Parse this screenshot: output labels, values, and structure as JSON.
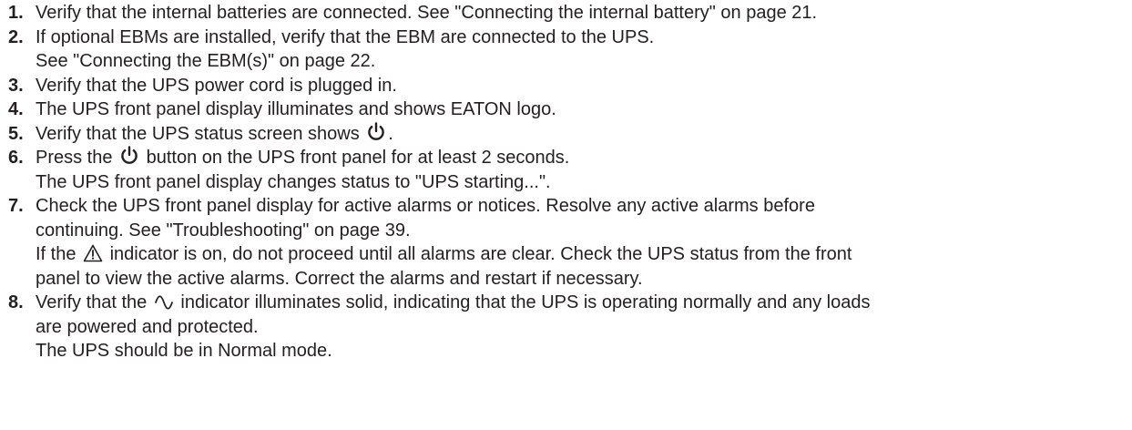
{
  "steps": [
    {
      "number": "1.",
      "lines": [
        "Verify that the internal batteries are connected. See \"Connecting the internal battery\" on page 21."
      ]
    },
    {
      "number": "2.",
      "lines": [
        "If optional EBMs are installed, verify that the EBM are connected to the UPS.",
        "See \"Connecting the EBM(s)\" on page 22."
      ]
    },
    {
      "number": "3.",
      "lines": [
        "Verify that the UPS power cord is plugged in."
      ]
    },
    {
      "number": "4.",
      "lines": [
        "The UPS front panel display illuminates and shows EATON logo."
      ]
    },
    {
      "number": "5.",
      "before": "Verify that the UPS status screen shows ",
      "icon": "power-icon",
      "after": "."
    },
    {
      "number": "6.",
      "before": "Press the ",
      "icon": "power-icon",
      "after": " button on the UPS front panel for at least 2 seconds.",
      "extra": "The UPS front panel display changes status to \"UPS starting...\"."
    },
    {
      "number": "7.",
      "lines": [
        "Check the UPS front panel display for active alarms or notices. Resolve any active alarms before",
        "continuing. See \"Troubleshooting\" on page 39."
      ],
      "before": "If the ",
      "icon": "warning-triangle-icon",
      "after": " indicator is on, do not proceed until all alarms are clear. Check the UPS status from the front",
      "extra": "panel to view the active alarms. Correct the alarms and restart if necessary."
    },
    {
      "number": "8.",
      "before": "Verify that the ",
      "icon": "ac-sine-wave-icon",
      "after": " indicator illuminates solid, indicating that the UPS is operating normally and any loads",
      "lines2": [
        "are powered and protected.",
        "The UPS should be in Normal mode."
      ]
    }
  ]
}
